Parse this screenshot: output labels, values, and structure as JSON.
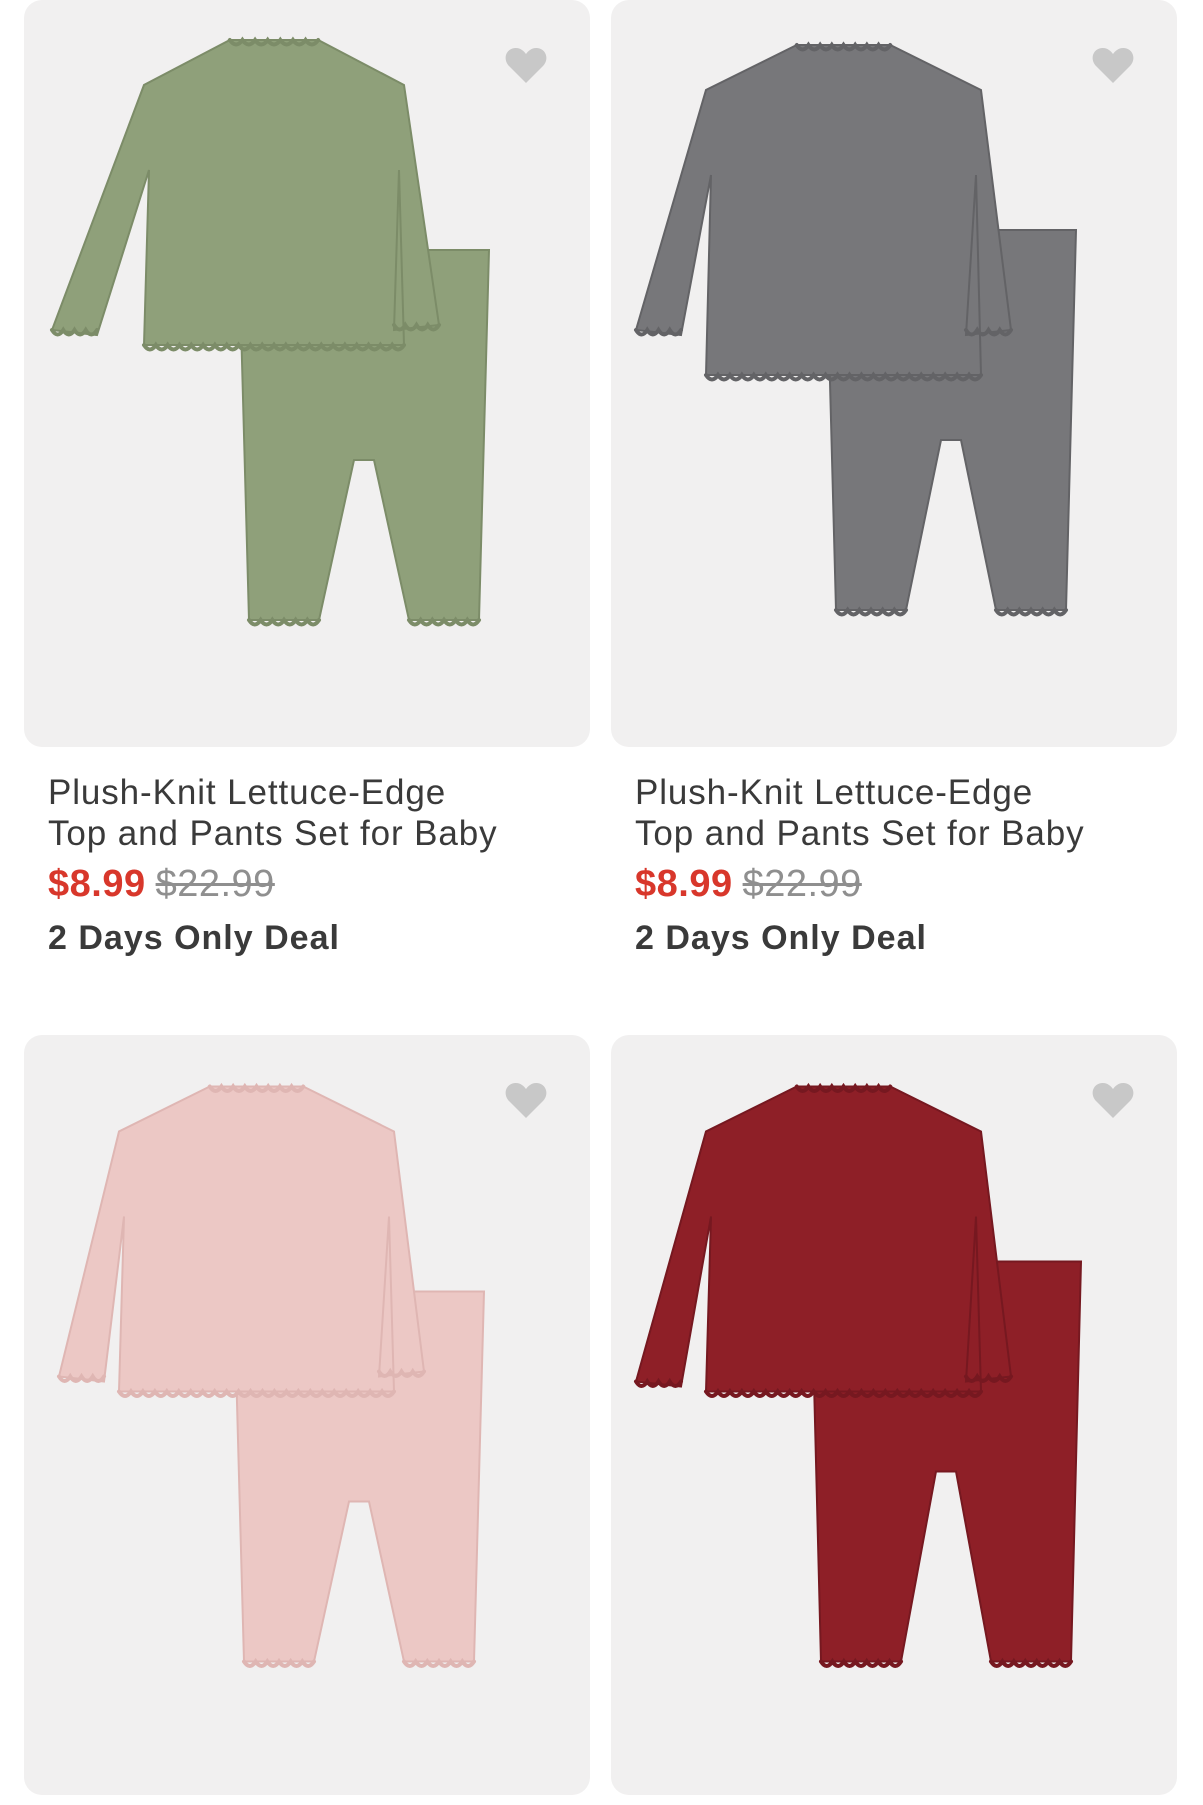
{
  "products": [
    {
      "title_line1": "Plush-Knit Lettuce-Edge",
      "title_line2": "Top and Pants Set for Baby",
      "sale_price": "$8.99",
      "original_price": "$22.99",
      "deal": "2 Days Only Deal",
      "color": "#8fa07a",
      "color_dark": "#7c8c68",
      "favorite_icon": "heart-icon"
    },
    {
      "title_line1": "Plush-Knit Lettuce-Edge",
      "title_line2": "Top and Pants Set for Baby",
      "sale_price": "$8.99",
      "original_price": "$22.99",
      "deal": "2 Days Only Deal",
      "color": "#77777a",
      "color_dark": "#636366",
      "favorite_icon": "heart-icon"
    },
    {
      "title_line1": "",
      "title_line2": "",
      "sale_price": "",
      "original_price": "",
      "deal": "",
      "color": "#ecc8c5",
      "color_dark": "#dfb6b3",
      "favorite_icon": "heart-icon"
    },
    {
      "title_line1": "",
      "title_line2": "",
      "sale_price": "",
      "original_price": "",
      "deal": "",
      "color": "#8e1f27",
      "color_dark": "#761820",
      "favorite_icon": "heart-icon"
    }
  ],
  "colors": {
    "sale": "#d8372b",
    "original": "#8f8f8f",
    "card_bg": "#f1f0f0",
    "heart": "#c8c8c8"
  }
}
